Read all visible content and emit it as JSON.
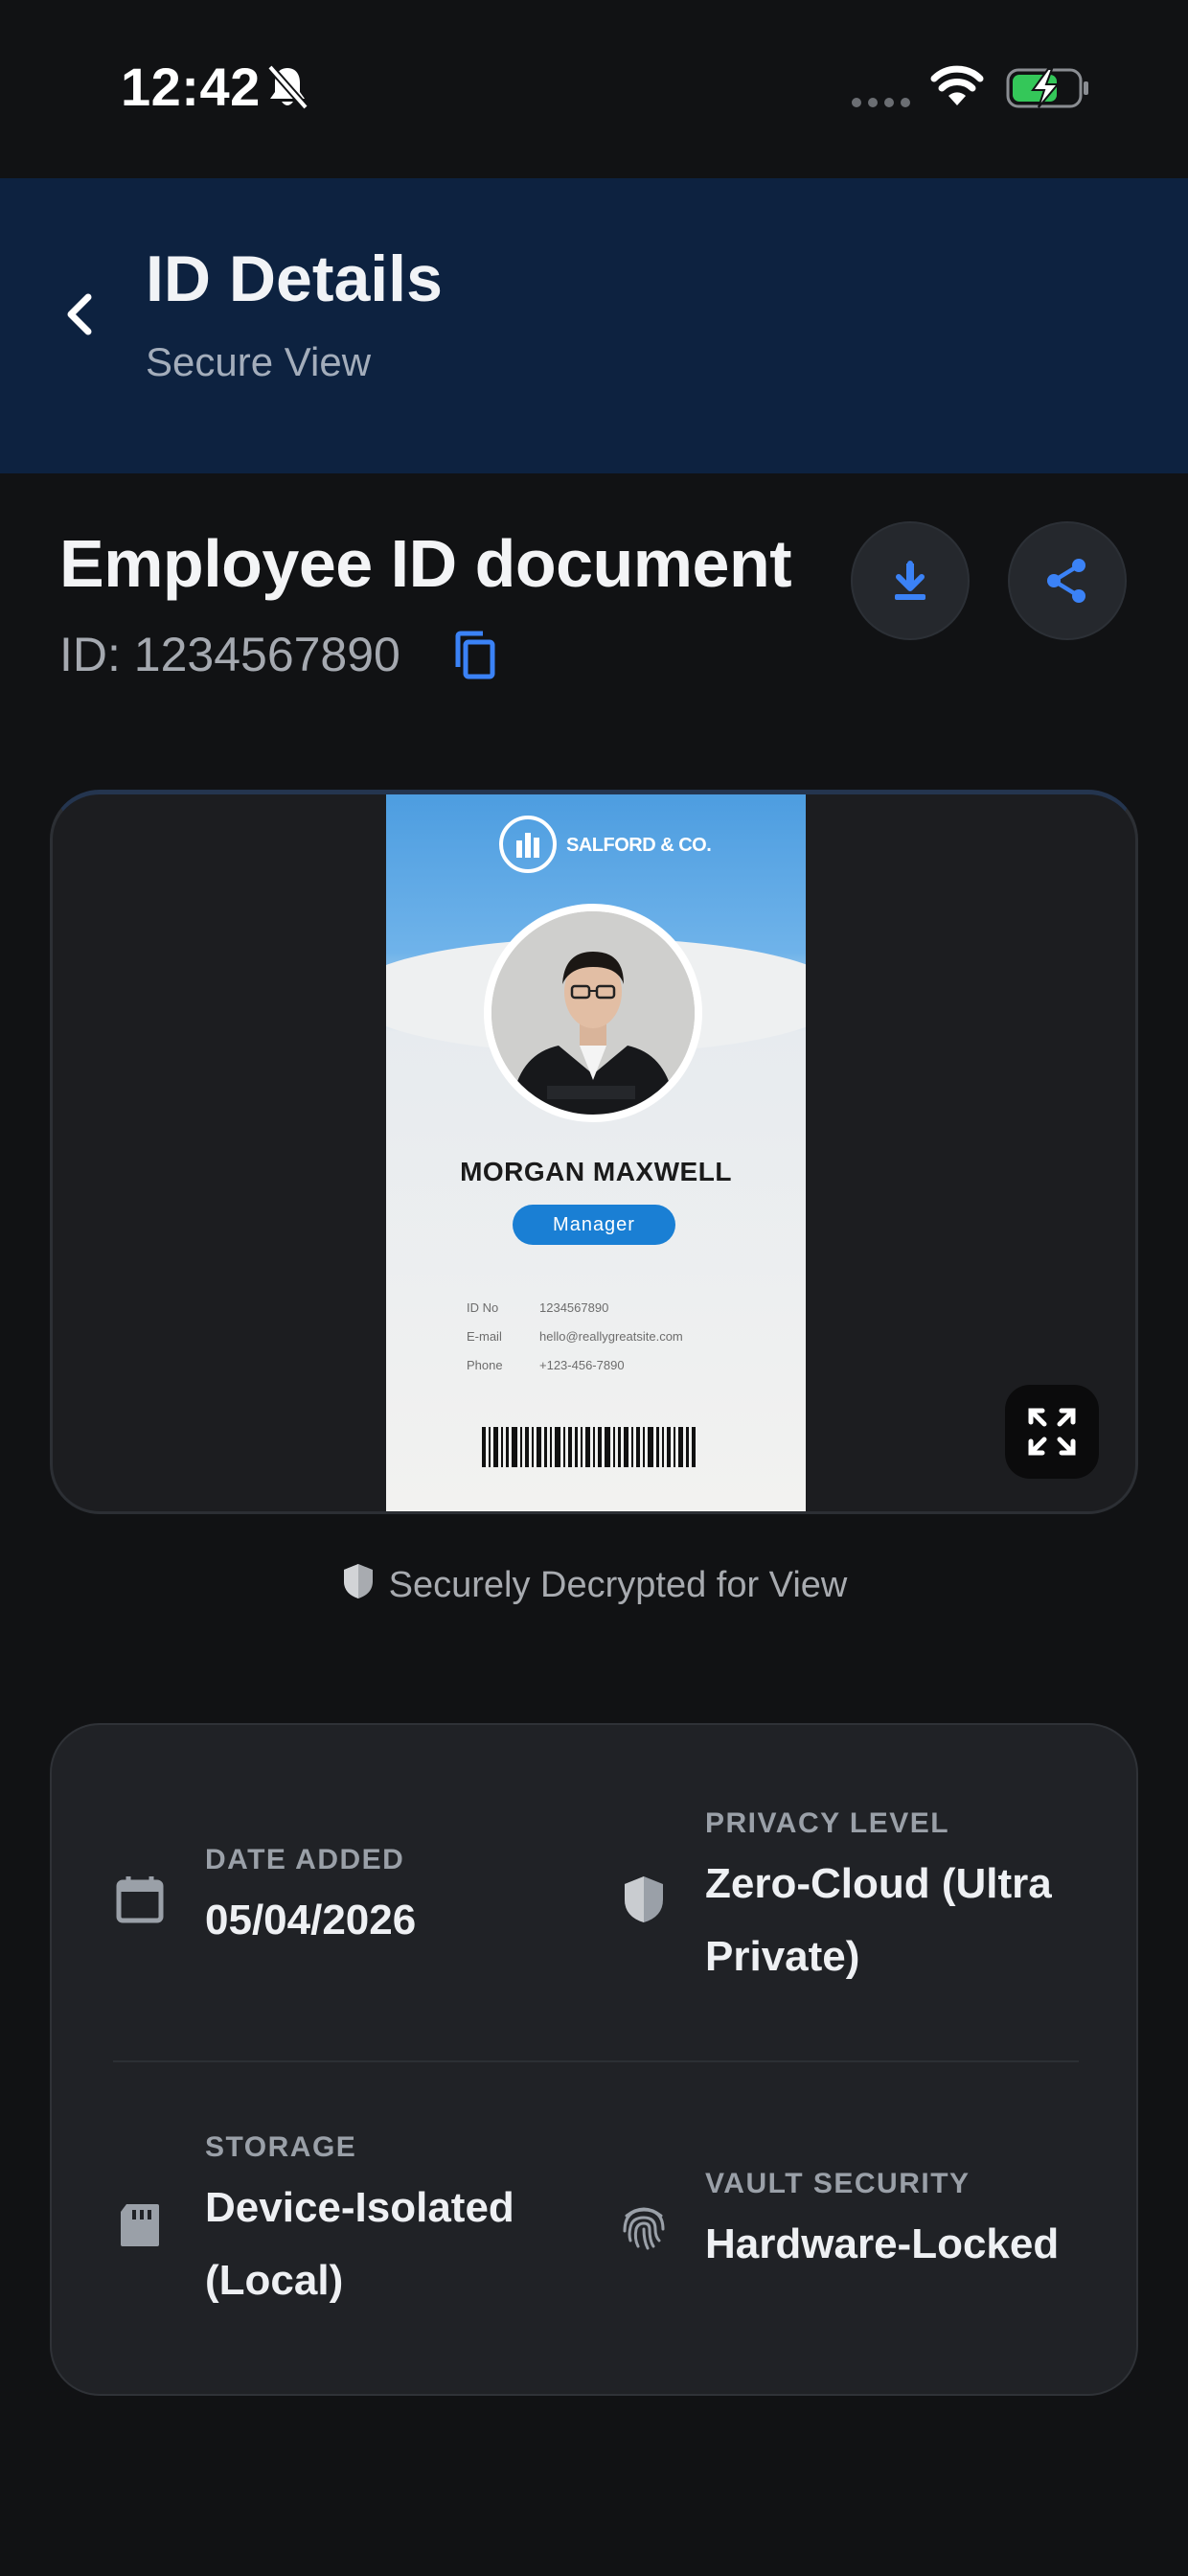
{
  "status_bar": {
    "time": "12:42"
  },
  "header": {
    "title": "ID Details",
    "subtitle": "Secure View"
  },
  "document": {
    "title": "Employee ID document",
    "id_text": "ID: 1234567890"
  },
  "id_card": {
    "company": "SALFORD & CO.",
    "name": "MORGAN MAXWELL",
    "role": "Manager",
    "fields": [
      {
        "label": "ID No",
        "value": "1234567890"
      },
      {
        "label": "E-mail",
        "value": "hello@reallygreatsite.com"
      },
      {
        "label": "Phone",
        "value": "+123-456-7890"
      }
    ]
  },
  "secure_note": "Securely Decrypted for View",
  "info": {
    "date_added": {
      "label": "DATE ADDED",
      "value": "05/04/2026"
    },
    "privacy_level": {
      "label": "PRIVACY LEVEL",
      "value_line1": "Zero-Cloud (Ultra",
      "value_line2": "Private)"
    },
    "storage": {
      "label": "STORAGE",
      "value_line1": "Device-Isolated",
      "value_line2": "(Local)"
    },
    "vault_security": {
      "label": "VAULT SECURITY",
      "value": "Hardware-Locked"
    }
  },
  "colors": {
    "background": "#111214",
    "header_bg": "#0d2240",
    "accent": "#3b82f6",
    "card_bg": "#202226"
  },
  "icons": {
    "bell": "bell-slash-icon",
    "back": "chevron-left-icon",
    "copy": "copy-icon",
    "download": "download-icon",
    "share": "share-icon",
    "expand": "fullscreen-icon",
    "shield": "shield-icon",
    "calendar": "calendar-icon",
    "sd_card": "sd-card-icon",
    "fingerprint": "fingerprint-icon"
  }
}
